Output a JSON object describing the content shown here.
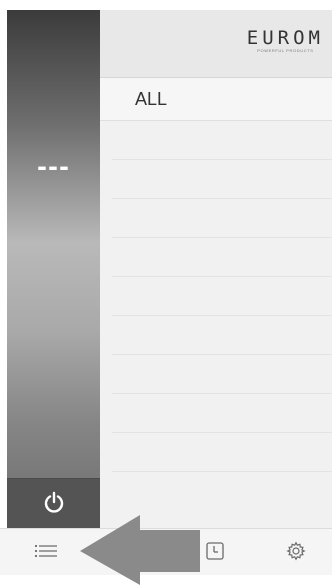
{
  "app": {
    "brand": "EURОM",
    "tagline": "POWERFUL PRODUCTS"
  },
  "side_panel": {
    "temperature_display": "---",
    "power_icon": "power-icon"
  },
  "main": {
    "group_label": "ALL",
    "empty_rows": 9
  },
  "toolbar": {
    "items": [
      {
        "icon": "menu-list-icon",
        "label": "Menu"
      },
      {
        "icon": "clock-icon",
        "label": "Timer"
      },
      {
        "icon": "gear-icon",
        "label": "Settings"
      }
    ]
  },
  "overlay": {
    "icon": "tutorial-arrow-icon",
    "color": "#8a8a8a"
  },
  "colors": {
    "panel_dark": "#3b3b3b",
    "panel_light": "#b9b9b9",
    "text": "#333333"
  }
}
